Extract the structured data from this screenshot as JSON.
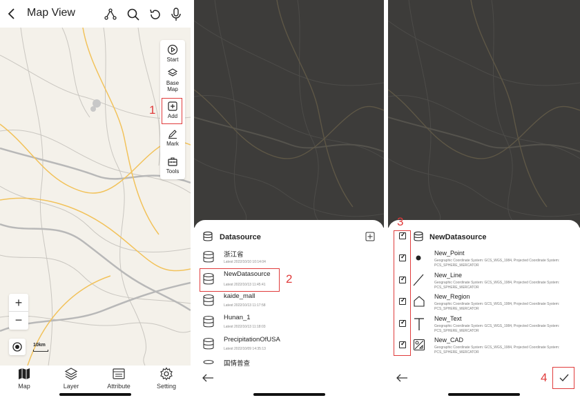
{
  "screen1": {
    "title": "Map View",
    "tools": [
      {
        "label": "Start",
        "icon": "play-circle-icon"
      },
      {
        "label": "Base\nMap",
        "icon": "layers-stack-icon"
      },
      {
        "label": "Add",
        "icon": "add-square-icon"
      },
      {
        "label": "Mark",
        "icon": "pen-icon"
      },
      {
        "label": "Tools",
        "icon": "toolbox-icon"
      }
    ],
    "step_number": "1",
    "zoom_in": "+",
    "zoom_out": "−",
    "scale_label": "10km",
    "nav": [
      {
        "label": "Map",
        "icon": "map-icon"
      },
      {
        "label": "Layer",
        "icon": "layer-icon"
      },
      {
        "label": "Attribute",
        "icon": "attribute-table-icon"
      },
      {
        "label": "Setting",
        "icon": "gear-icon"
      }
    ]
  },
  "screen2": {
    "header": "Datasource",
    "step_number": "2",
    "datasources": [
      {
        "name": "浙江省",
        "date": "Latest 2022/10/10  10:14:04"
      },
      {
        "name": "NewDatasource",
        "date": "Latest 2022/10/13  11:45:41"
      },
      {
        "name": "kaide_mall",
        "date": "Latest 2022/10/13  11:17:58"
      },
      {
        "name": "Hunan_1",
        "date": "Latest 2022/10/13  11:18:03"
      },
      {
        "name": "PrecipitationOfUSA",
        "date": "Latest 2022/10/09  14:35:13"
      },
      {
        "name": "国情普查",
        "date": ""
      }
    ]
  },
  "screen3": {
    "header": "NewDatasource",
    "step_number_3": "3",
    "step_number_4": "4",
    "check_glyph": "✓",
    "datasets": [
      {
        "name": "New_Point",
        "icon": "point-icon",
        "checked": true,
        "info": "Geographic Coordinate System: GCS_WGS_1984, Projected Coordinate System: PCS_SPHERE_MERCATOR"
      },
      {
        "name": "New_Line",
        "icon": "line-icon",
        "checked": true,
        "info": "Geographic Coordinate System: GCS_WGS_1984, Projected Coordinate System: PCS_SPHERE_MERCATOR"
      },
      {
        "name": "New_Region",
        "icon": "region-icon",
        "checked": true,
        "info": "Geographic Coordinate System: GCS_WGS_1984, Projected Coordinate System: PCS_SPHERE_MERCATOR"
      },
      {
        "name": "New_Text",
        "icon": "text-icon",
        "checked": true,
        "info": "Geographic Coordinate System: GCS_WGS_1984, Projected Coordinate System: PCS_SPHERE_MERCATOR"
      },
      {
        "name": "New_CAD",
        "icon": "cad-icon",
        "checked": true,
        "info": "Geographic Coordinate System: GCS_WGS_1984, Projected Coordinate System: PCS_SPHERE_MERCATOR"
      }
    ]
  },
  "colors": {
    "annotation": "#e03a3a",
    "map_light": "#f4f1ea",
    "map_dark": "#3d3c3a",
    "road_major": "#f2c25a"
  }
}
